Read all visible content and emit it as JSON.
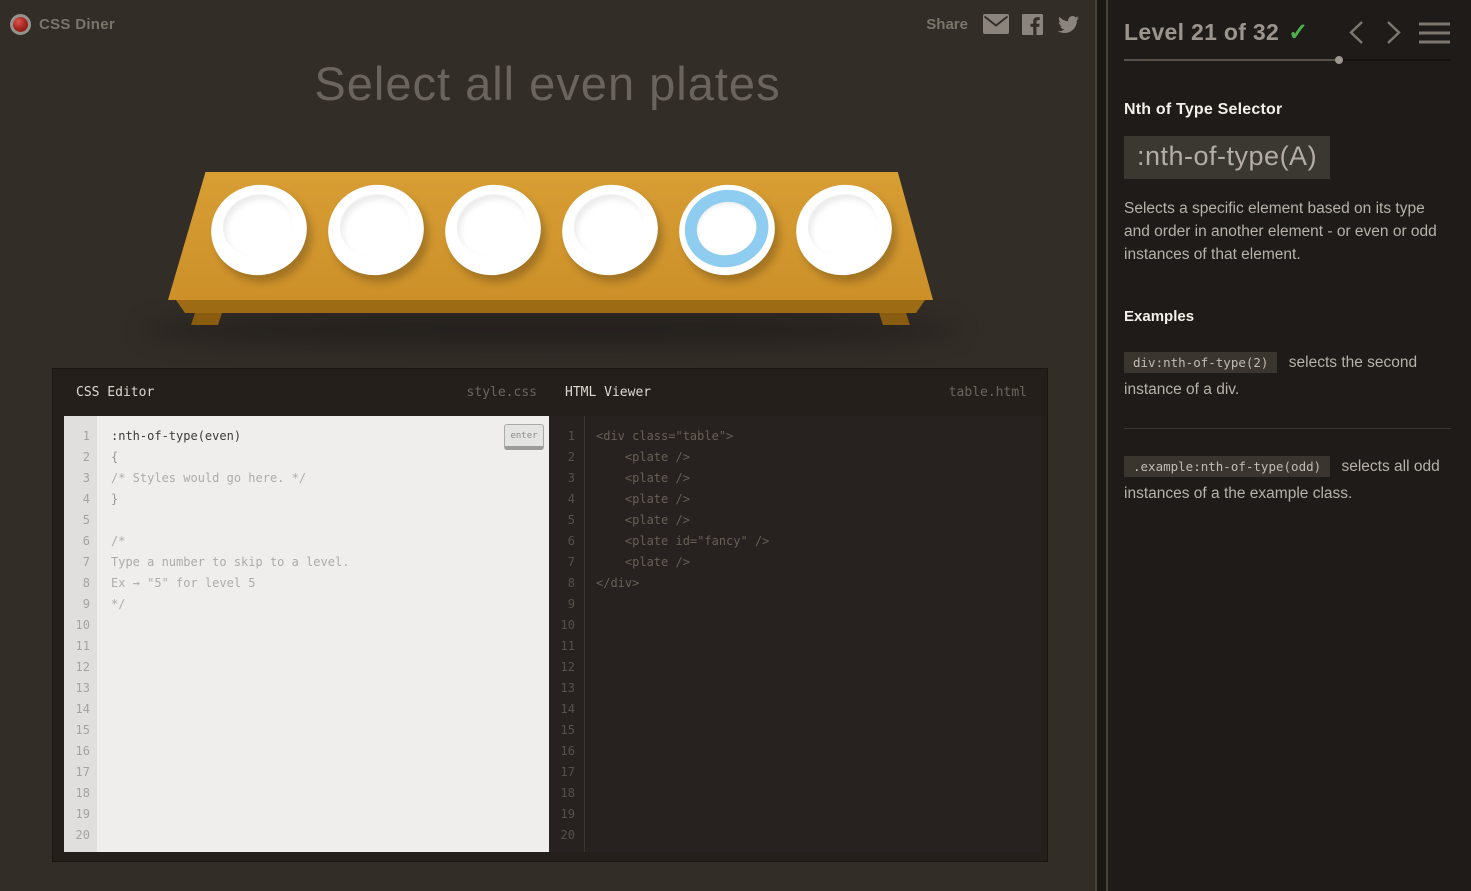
{
  "header": {
    "logo_text": "CSS Diner",
    "share_label": "Share"
  },
  "main": {
    "instruction": "Select all even plates",
    "plates": [
      {
        "fancy": false
      },
      {
        "fancy": false
      },
      {
        "fancy": false
      },
      {
        "fancy": false
      },
      {
        "fancy": true
      },
      {
        "fancy": false
      }
    ]
  },
  "editors": {
    "css": {
      "title": "CSS Editor",
      "filename": "style.css",
      "enter_label": "enter",
      "lines": [
        {
          "n": 1,
          "text": ":nth-of-type(even)",
          "kind": "input"
        },
        {
          "n": 2,
          "text": "{",
          "kind": "code"
        },
        {
          "n": 3,
          "text": "/* Styles would go here. */",
          "kind": "comment"
        },
        {
          "n": 4,
          "text": "}",
          "kind": "code"
        },
        {
          "n": 5,
          "text": "",
          "kind": ""
        },
        {
          "n": 6,
          "text": "/*",
          "kind": "comment"
        },
        {
          "n": 7,
          "text": "Type a number to skip to a level.",
          "kind": "comment"
        },
        {
          "n": 8,
          "text": "Ex → \"5\" for level 5",
          "kind": "comment"
        },
        {
          "n": 9,
          "text": "*/",
          "kind": "comment"
        },
        {
          "n": 10,
          "text": "",
          "kind": ""
        },
        {
          "n": 11,
          "text": "",
          "kind": ""
        },
        {
          "n": 12,
          "text": "",
          "kind": ""
        },
        {
          "n": 13,
          "text": "",
          "kind": ""
        },
        {
          "n": 14,
          "text": "",
          "kind": ""
        },
        {
          "n": 15,
          "text": "",
          "kind": ""
        },
        {
          "n": 16,
          "text": "",
          "kind": ""
        },
        {
          "n": 17,
          "text": "",
          "kind": ""
        },
        {
          "n": 18,
          "text": "",
          "kind": ""
        },
        {
          "n": 19,
          "text": "",
          "kind": ""
        },
        {
          "n": 20,
          "text": "",
          "kind": ""
        }
      ]
    },
    "html": {
      "title": "HTML Viewer",
      "filename": "table.html",
      "lines": [
        {
          "n": 1,
          "text": "<div class=\"table\">",
          "kind": ""
        },
        {
          "n": 2,
          "text": "    <plate />",
          "kind": ""
        },
        {
          "n": 3,
          "text": "    <plate />",
          "kind": ""
        },
        {
          "n": 4,
          "text": "    <plate />",
          "kind": ""
        },
        {
          "n": 5,
          "text": "    <plate />",
          "kind": ""
        },
        {
          "n": 6,
          "text": "    <plate id=\"fancy\" />",
          "kind": ""
        },
        {
          "n": 7,
          "text": "    <plate />",
          "kind": ""
        },
        {
          "n": 8,
          "text": "</div>",
          "kind": ""
        },
        {
          "n": 9,
          "text": "",
          "kind": ""
        },
        {
          "n": 10,
          "text": "",
          "kind": ""
        },
        {
          "n": 11,
          "text": "",
          "kind": ""
        },
        {
          "n": 12,
          "text": "",
          "kind": ""
        },
        {
          "n": 13,
          "text": "",
          "kind": ""
        },
        {
          "n": 14,
          "text": "",
          "kind": ""
        },
        {
          "n": 15,
          "text": "",
          "kind": ""
        },
        {
          "n": 16,
          "text": "",
          "kind": ""
        },
        {
          "n": 17,
          "text": "",
          "kind": ""
        },
        {
          "n": 18,
          "text": "",
          "kind": ""
        },
        {
          "n": 19,
          "text": "",
          "kind": ""
        },
        {
          "n": 20,
          "text": "",
          "kind": ""
        }
      ]
    }
  },
  "sidebar": {
    "level_label": "Level 21 of 32",
    "check_icon": "✓",
    "progress_percent": 65.6,
    "lesson": {
      "title": "Nth of Type Selector",
      "selector": ":nth-of-type(A)",
      "description": "Selects a specific element based on its type and order in another element - or even or odd instances of that element."
    },
    "examples": {
      "heading": "Examples",
      "items": [
        {
          "code": "div:nth-of-type(2)",
          "text": "selects the second instance of a div."
        },
        {
          "code": ".example:nth-of-type(odd)",
          "text": "selects all odd instances of a the example class."
        }
      ]
    }
  },
  "colors": {
    "table_orange": "#d79e34",
    "fancy_plate_blue": "#8ecdf0",
    "success_green": "#4bb24e",
    "background": "#332d28",
    "sidebar_background": "#1f1b18"
  }
}
